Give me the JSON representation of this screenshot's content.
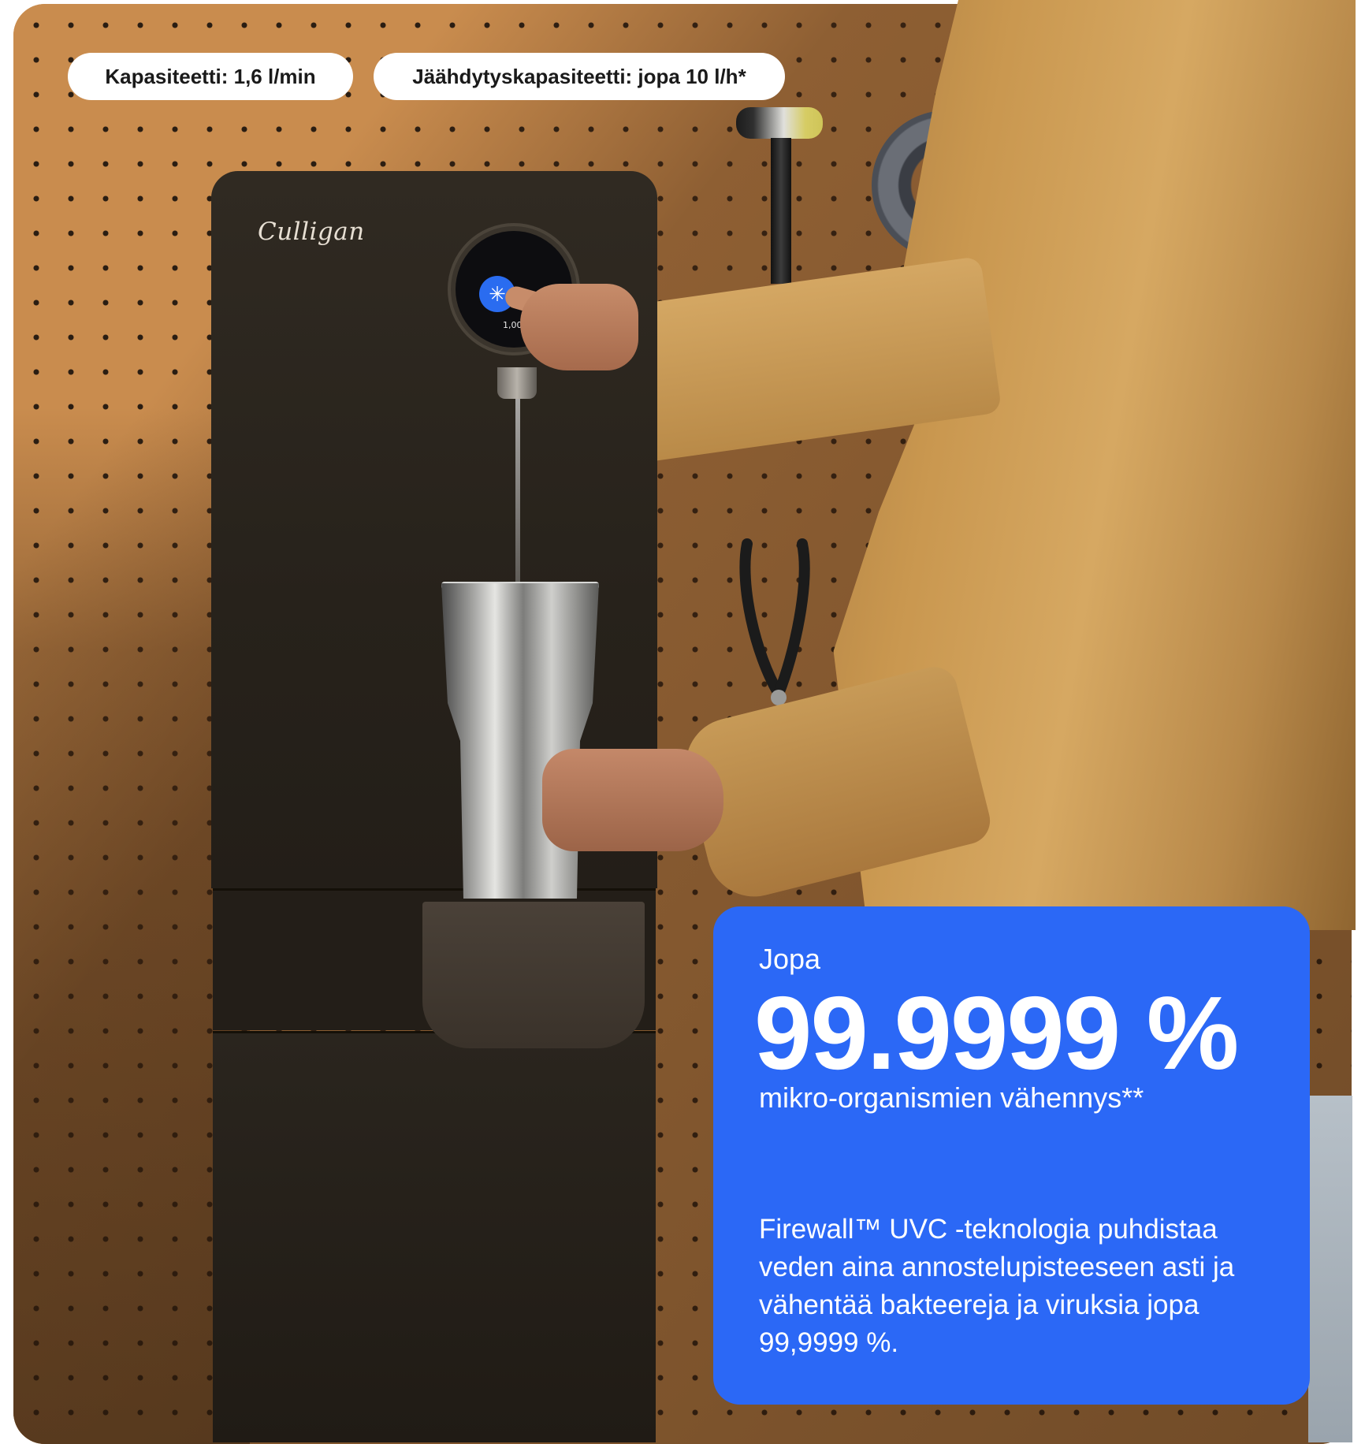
{
  "specs": {
    "capacity": "Kapasiteetti: 1,6 l/min",
    "cooling_capacity": "Jäähdytyskapasiteetti: jopa 10 l/h*"
  },
  "product": {
    "brand": "Culligan",
    "screen_value": "1,009,76"
  },
  "info_card": {
    "eyebrow": "Jopa",
    "stat": "99.9999 %",
    "caption": "mikro-organismien vähennys**",
    "body": "Firewall™ UVC -teknologia puhdistaa veden aina annostelupisteeseen asti ja vähentää bakteereja ja viruksia jopa 99,9999 %."
  },
  "colors": {
    "card_blue": "#2b68f6",
    "pegboard": "#c98c4e",
    "dispenser": "#27221b"
  }
}
